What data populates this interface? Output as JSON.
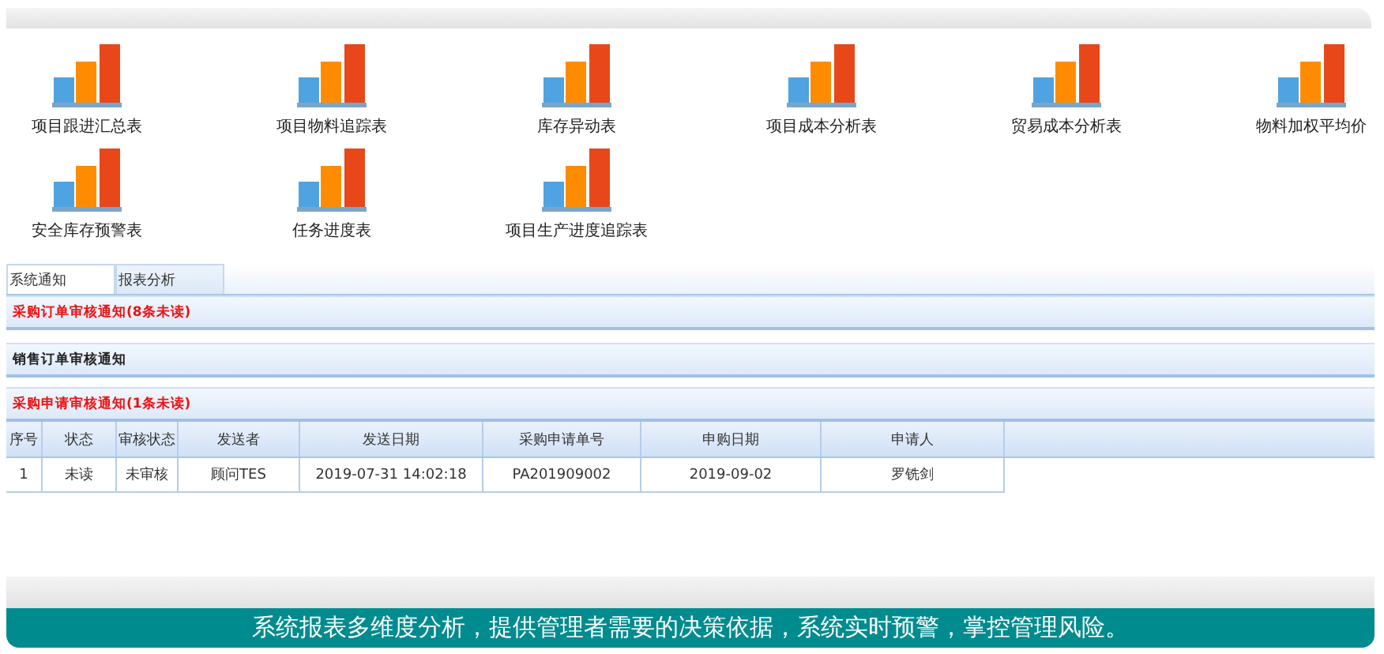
{
  "reports": [
    {
      "label": "项目跟进汇总表"
    },
    {
      "label": "项目物料追踪表"
    },
    {
      "label": "库存异动表"
    },
    {
      "label": "项目成本分析表"
    },
    {
      "label": "贸易成本分析表"
    },
    {
      "label": "物料加权平均价"
    },
    {
      "label": "安全库存预警表"
    },
    {
      "label": "任务进度表"
    },
    {
      "label": "项目生产进度追踪表"
    }
  ],
  "tabs": [
    {
      "label": "系统通知",
      "selected": true
    },
    {
      "label": "报表分析",
      "selected": false
    }
  ],
  "notices": [
    {
      "title": "采购订单审核通知(8条未读)",
      "unread": true
    },
    {
      "title": "销售订单审核通知",
      "unread": false
    },
    {
      "title": "采购申请审核通知(1条未读)",
      "unread": true
    }
  ],
  "table": {
    "columns": [
      "序号",
      "状态",
      "审核状态",
      "发送者",
      "发送日期",
      "采购申请单号",
      "申购日期",
      "申请人"
    ],
    "rows": [
      [
        "1",
        "未读",
        "未审核",
        "顾问TES",
        "2019-07-31 14:02:18",
        "PA201909002",
        "2019-09-02",
        "罗铣剑"
      ]
    ]
  },
  "banner": "系统报表多维度分析，提供管理者需要的决策依据，系统实时预警，掌控管理风险。"
}
